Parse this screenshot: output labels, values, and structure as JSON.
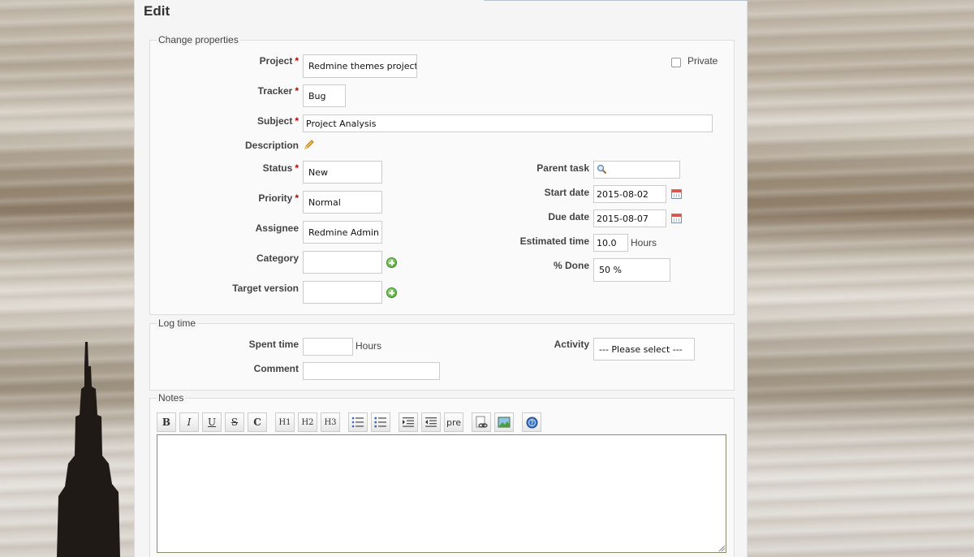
{
  "page": {
    "title": "Edit"
  },
  "properties": {
    "legend": "Change properties",
    "project": {
      "label": "Project",
      "value": "Redmine themes project"
    },
    "private": {
      "label": "Private"
    },
    "tracker": {
      "label": "Tracker",
      "value": "Bug"
    },
    "subject": {
      "label": "Subject",
      "value": "Project Analysis"
    },
    "description": {
      "label": "Description"
    },
    "status": {
      "label": "Status",
      "value": "New"
    },
    "priority": {
      "label": "Priority",
      "value": "Normal"
    },
    "assignee": {
      "label": "Assignee",
      "value": "Redmine Admin"
    },
    "category": {
      "label": "Category",
      "value": ""
    },
    "target_version": {
      "label": "Target version",
      "value": ""
    },
    "parent_task": {
      "label": "Parent task",
      "value": ""
    },
    "start_date": {
      "label": "Start date",
      "value": "2015-08-02"
    },
    "due_date": {
      "label": "Due date",
      "value": "2015-08-07"
    },
    "estimated_time": {
      "label": "Estimated time",
      "value": "10.0",
      "unit": "Hours"
    },
    "done": {
      "label": "% Done",
      "value": "50 %"
    },
    "required_mark": "*"
  },
  "log_time": {
    "legend": "Log time",
    "spent_time": {
      "label": "Spent time",
      "value": "",
      "unit": "Hours"
    },
    "comment": {
      "label": "Comment",
      "value": ""
    },
    "activity": {
      "label": "Activity",
      "value": "--- Please select ---"
    }
  },
  "notes": {
    "legend": "Notes",
    "toolbar": {
      "bold": "B",
      "italic": "I",
      "underline": "U",
      "strike": "S",
      "code": "C",
      "h1": "H1",
      "h2": "H2",
      "h3": "H3",
      "pre": "pre"
    }
  },
  "icons": {
    "pencil": "pencil-icon",
    "magnifier": "search-icon",
    "calendar": "calendar-icon",
    "add": "add-icon",
    "help": "help-icon"
  }
}
